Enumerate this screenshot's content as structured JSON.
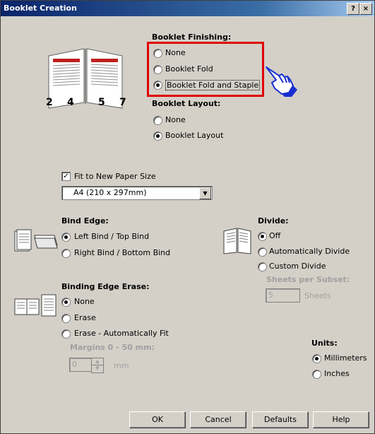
{
  "window": {
    "title": "Booklet Creation",
    "help_btn": "?",
    "close_btn": "×"
  },
  "booklet_finishing": {
    "header": "Booklet Finishing:",
    "options": [
      "None",
      "Booklet Fold",
      "Booklet Fold and Staple"
    ],
    "selected": "Booklet Fold and Staple"
  },
  "booklet_layout": {
    "header": "Booklet Layout:",
    "options": [
      "None",
      "Booklet Layout"
    ],
    "selected": "Booklet Layout"
  },
  "fit": {
    "label": "Fit to New Paper Size",
    "checked": true,
    "paper_size": "A4 (210 x 297mm)"
  },
  "bind_edge": {
    "header": "Bind Edge:",
    "options": [
      "Left Bind / Top Bind",
      "Right Bind / Bottom Bind"
    ],
    "selected": "Left Bind / Top Bind"
  },
  "divide": {
    "header": "Divide:",
    "options": [
      "Off",
      "Automatically Divide",
      "Custom Divide"
    ],
    "selected": "Off",
    "sheets_per_subset_label": "Sheets per Subset:",
    "sheets_value": "5",
    "sheets_unit": "Sheets"
  },
  "binding_edge_erase": {
    "header": "Binding Edge Erase:",
    "options": [
      "None",
      "Erase",
      "Erase - Automatically Fit"
    ],
    "selected": "None",
    "margins_label": "Margins 0 - 50 mm:",
    "margin_value": "0",
    "margin_unit": "mm"
  },
  "units": {
    "header": "Units:",
    "options": [
      "Millimeters",
      "Inches"
    ],
    "selected": "Millimeters"
  },
  "preview_pages": [
    "2",
    "4",
    "5",
    "7"
  ],
  "buttons": {
    "ok": "OK",
    "cancel": "Cancel",
    "defaults": "Defaults",
    "help": "Help"
  },
  "colors": {
    "highlight_box": "#e00000",
    "pointer_hand": "#1a2fd0"
  }
}
